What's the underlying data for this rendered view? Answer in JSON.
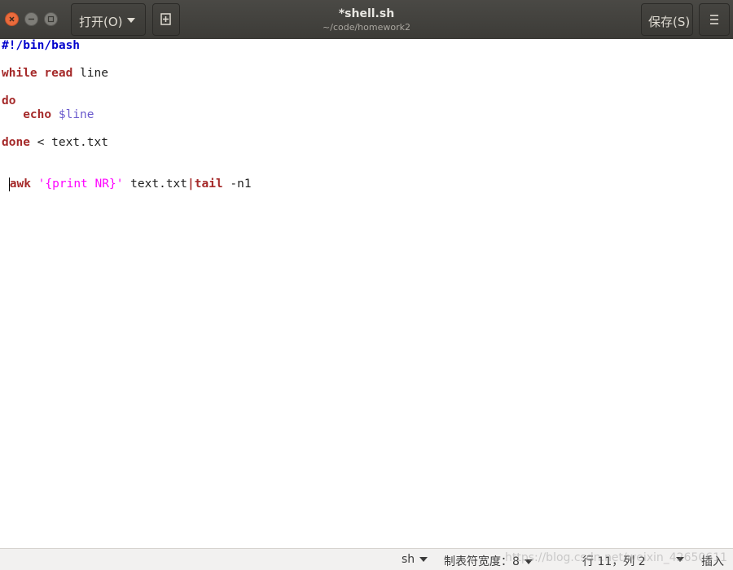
{
  "window": {
    "title": "*shell.sh",
    "subtitle": "~/code/homework2",
    "open_label": "打开(O)",
    "save_label": "保存(S)",
    "menu_icon": "hamburger-menu-icon",
    "new_doc_icon": "new-document-icon"
  },
  "editor": {
    "line1": {
      "shebang": "#!/bin/bash"
    },
    "line3": {
      "kw": "while",
      "kw2": "read",
      "rest": " line"
    },
    "line5": {
      "kw": "do"
    },
    "line6": {
      "indent": "   ",
      "kw": "echo",
      "var": "$line"
    },
    "line8": {
      "kw": "done",
      "rest": " < text.txt"
    },
    "line11": {
      "indent": " ",
      "cmd": "awk",
      "str": "'{print NR}'",
      "mid": " text.txt",
      "pipe": "|",
      "kw": "tail",
      "rest": " -n1"
    }
  },
  "status": {
    "language": "sh",
    "tab_width_label": "制表符宽度：",
    "tab_width": "8",
    "position": "行 11，列 2",
    "mode": "插入",
    "watermark": "https://blog.csdn.net/weixin_42650611"
  },
  "colors": {
    "titlebar": "#3c3b37",
    "close": "#ea6b3c",
    "keyword": "#a52a2a",
    "shebang": "#0000cc",
    "string": "#ff00ff",
    "variable": "#6a5acd"
  }
}
